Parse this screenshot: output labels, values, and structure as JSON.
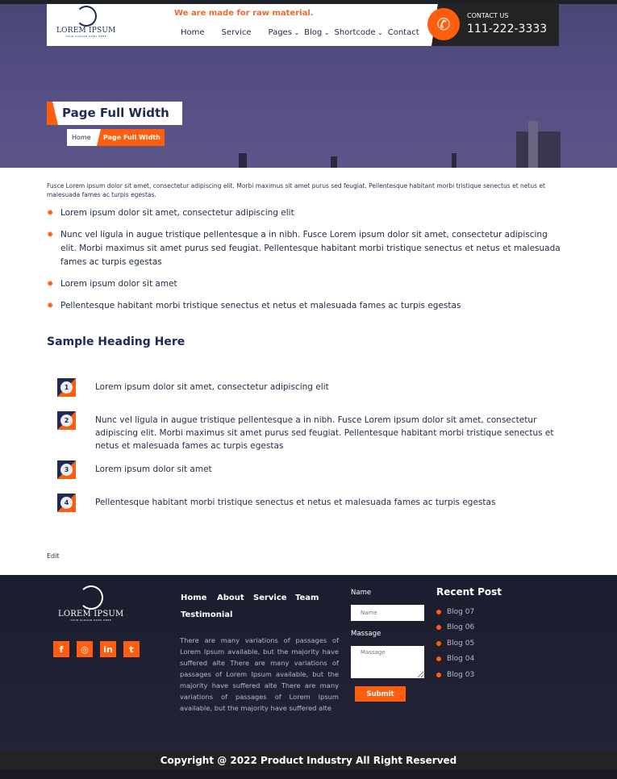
{
  "header": {
    "logo_text": "LOREM IPSUM",
    "logo_sub": "YOUR SLOGAN GOES HERE",
    "tagline": "We are made for raw material.",
    "nav": [
      {
        "label": "Home"
      },
      {
        "label": "Service"
      },
      {
        "label": "Pages",
        "dropdown": true
      },
      {
        "label": "Blog",
        "dropdown": true
      },
      {
        "label": "Shortcode",
        "dropdown": true
      },
      {
        "label": "Contact"
      }
    ],
    "contact_label": "CONTACT US",
    "phone": "111-222-3333",
    "phone_icon": "phone-icon"
  },
  "hero": {
    "title": "Page Full Width",
    "breadcrumb": [
      "Home",
      "Page Full Width"
    ]
  },
  "content": {
    "intro": "Fusce Lorem ipsum dolor sit amet, consectetur adipiscing elit. Morbi maximus sit amet purus sed feugiat. Pellentesque habitant morbi tristique senectus et netus et malesuada fames ac turpis egestas.",
    "bullets": [
      "Lorem ipsum dolor sit amet, consectetur adipiscing elit",
      "Nunc vel ligula in augue tristique pellentesque a in nibh. Fusce Lorem ipsum dolor sit amet, consectetur adipiscing elit. Morbi maximus sit amet purus sed feugiat. Pellentesque habitant morbi tristique senectus et netus et malesuada fames ac turpis egestas",
      "Lorem ipsum dolor sit amet",
      "Pellentesque habitant morbi tristique senectus et netus et malesuada fames ac turpis egestas"
    ],
    "heading": "Sample Heading Here",
    "numbered": [
      {
        "n": "1",
        "text": "Lorem ipsum dolor sit amet, consectetur adipiscing elit"
      },
      {
        "n": "2",
        "text": "Nunc vel ligula in augue tristique pellentesque a in nibh. Fusce Lorem ipsum dolor sit amet, consectetur adipiscing elit. Morbi maximus sit amet purus sed feugiat. Pellentesque habitant morbi tristique senectus et netus et malesuada fames ac turpis egestas"
      },
      {
        "n": "3",
        "text": "Lorem ipsum dolor sit amet"
      },
      {
        "n": "4",
        "text": "Pellentesque habitant morbi tristique senectus et netus et malesuada fames ac turpis egestas"
      }
    ],
    "edit": "Edit"
  },
  "footer": {
    "logo_text": "LOREM IPSUM",
    "logo_sub": "YOUR SLOGAN GOES HERE",
    "social": [
      {
        "icon": "facebook-icon",
        "glyph": "f"
      },
      {
        "icon": "instagram-icon",
        "glyph": "◎"
      },
      {
        "icon": "linkedin-icon",
        "glyph": "in"
      },
      {
        "icon": "twitter-icon",
        "glyph": "t"
      }
    ],
    "links": [
      "Home",
      "About",
      "Service",
      "Team",
      "Testimonial"
    ],
    "paragraph": "There are many variations of passages of Lorem Ipsum available, but the majority have suffered alte There are many variations of passages of Lorem Ipsum available, but the majority have suffered alte There are many variations of passages of Lorem Ipsum available, but the majority have suffered alte",
    "form": {
      "name_label": "Name",
      "name_placeholder": "Name",
      "message_label": "Massage",
      "message_placeholder": "Massage",
      "submit": "Submit"
    },
    "recent_title": "Recent Post",
    "recent": [
      "Blog 07",
      "Blog 06",
      "Blog 05",
      "Blog 04",
      "Blog 03"
    ],
    "copyright": "Copyright @ 2022 Product Industry All Right Reserved"
  },
  "colors": {
    "accent": "#ff5e0e",
    "navy": "#1f2a55",
    "dark": "#232323"
  }
}
